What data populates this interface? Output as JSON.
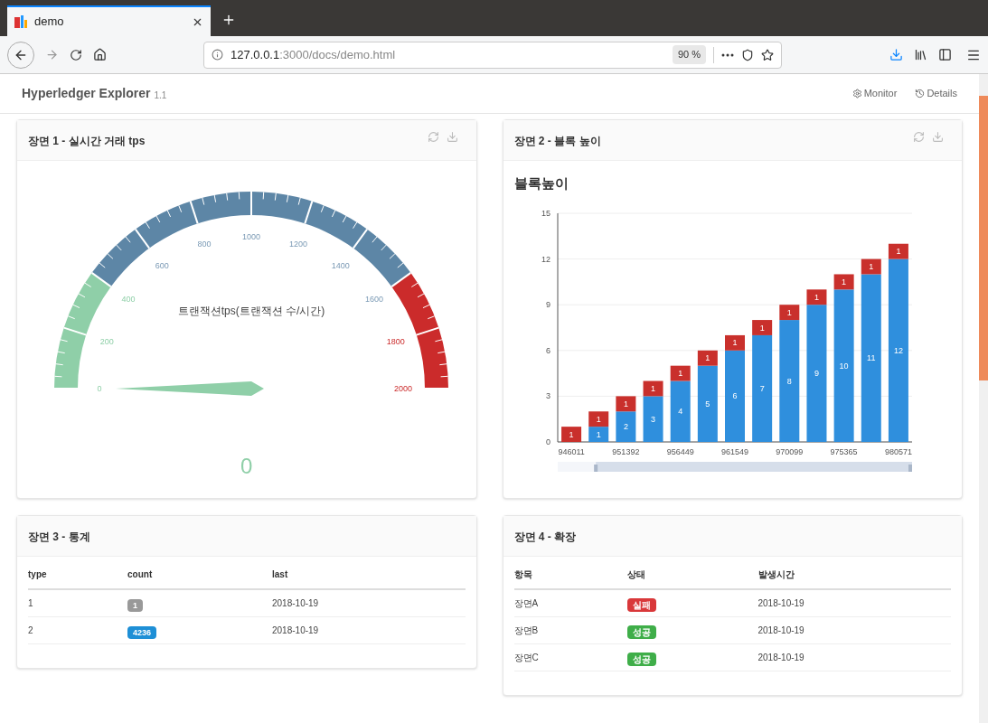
{
  "browser": {
    "tab": {
      "title": "demo"
    },
    "address": {
      "host": "127.0.0.1",
      "path": ":3000/docs/demo.html"
    },
    "zoom": "90 %"
  },
  "header": {
    "title": "Hyperledger Explorer",
    "version": "1.1",
    "links": [
      "Monitor",
      "Details"
    ]
  },
  "panel_1": {
    "title": "장면 1 - 실시간 거래 tps",
    "gauge": {
      "ticks": [
        "0",
        "200",
        "400",
        "600",
        "800",
        "1000",
        "1200",
        "1400",
        "1600",
        "1800",
        "2000"
      ],
      "label": "트랜잭션tps(트랜잭션 수/시간)",
      "value": "0"
    }
  },
  "panel_2": {
    "title": "장면 2 - 블록 높이",
    "chart_data": {
      "type": "bar",
      "title": "블록높이",
      "stacked": true,
      "categories": [
        "946011",
        null,
        "951392",
        null,
        "956449",
        null,
        "961549",
        null,
        "970099",
        null,
        "975365",
        null,
        "980571"
      ],
      "series": [
        {
          "color": "#2f8fdd",
          "values": [
            0,
            1,
            2,
            3,
            4,
            5,
            6,
            7,
            8,
            9,
            10,
            11,
            12
          ]
        },
        {
          "color": "#c9302c",
          "values": [
            1,
            1,
            1,
            1,
            1,
            1,
            1,
            1,
            1,
            1,
            1,
            1,
            1
          ]
        }
      ],
      "value_labels": [
        [
          null,
          "1",
          "2",
          "3",
          "4",
          "5",
          "6",
          "7",
          "8",
          "9",
          "10",
          "11",
          "12"
        ],
        [
          "1",
          "1",
          "1",
          "1",
          "1",
          "1",
          "1",
          "1",
          "1",
          "1",
          "1",
          "1",
          "1"
        ]
      ],
      "grid": true,
      "ylim": [
        0,
        15
      ],
      "yticks": [
        0,
        3,
        6,
        9,
        12,
        15
      ]
    }
  },
  "panel_3": {
    "title": "장면 3 - 통계",
    "columns": [
      "type",
      "count",
      "last"
    ],
    "rows": [
      {
        "type_value": "1",
        "count": "1",
        "color": "#999999",
        "last": "2018-10-19"
      },
      {
        "type_value": "2",
        "count": "4236",
        "color": "#1e8fd6",
        "last": "2018-10-19"
      }
    ]
  },
  "panel_4": {
    "title": "장면 4 - 확장",
    "columns": [
      "항목",
      "상태",
      "발생시간"
    ],
    "rows": [
      {
        "item": "장면A",
        "status": "실패",
        "color": "#d9383a",
        "time": "2018-10-19"
      },
      {
        "item": "장면B",
        "status": "성공",
        "color": "#3fae49",
        "time": "2018-10-19"
      },
      {
        "item": "장면C",
        "status": "성공",
        "color": "#3fae49",
        "time": "2018-10-19"
      }
    ]
  }
}
